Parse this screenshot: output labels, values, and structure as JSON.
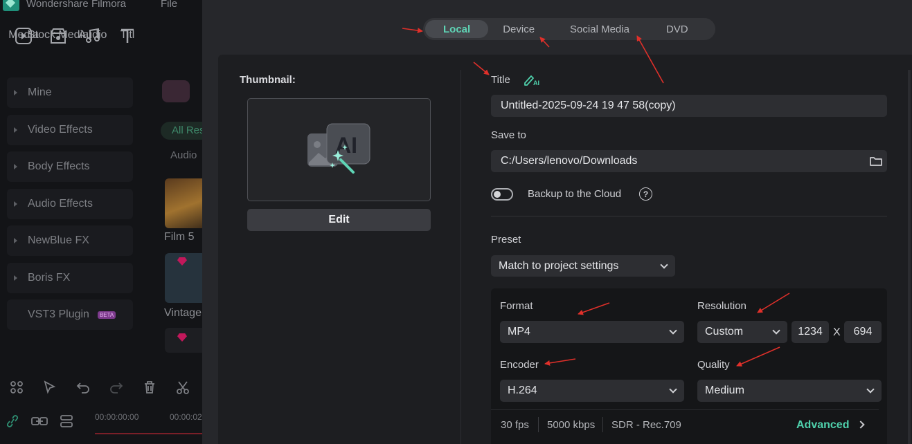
{
  "background_app": {
    "app_name": "Wondershare Filmora",
    "menu_file": "File",
    "toolbar": [
      "Media",
      "Stock Media",
      "Audio",
      "Titl"
    ],
    "sidebar": [
      "Mine",
      "Video Effects",
      "Body Effects",
      "Audio Effects",
      "NewBlue FX",
      "Boris FX",
      "VST3 Plugin"
    ],
    "beta_badge": "BETA",
    "filter_all": "All Res",
    "filter_audio": "Audio",
    "cards": [
      "Film 5",
      "Vintage"
    ],
    "timecode_start": "00:00:00:00",
    "timecode_next": "00:00:02"
  },
  "tabs": [
    "Local",
    "Device",
    "Social Media",
    "DVD"
  ],
  "active_tab": "Local",
  "thumbnail": {
    "label": "Thumbnail:",
    "edit_button": "Edit",
    "ai_badge": "AI"
  },
  "form": {
    "title_label": "Title",
    "ai_badge": "AI",
    "title_value": "Untitled-2025-09-24 19 47 58(copy)",
    "save_to_label": "Save to",
    "save_to_value": "C:/Users/lenovo/Downloads",
    "backup_label": "Backup to the Cloud",
    "backup_enabled": false,
    "help_glyph": "?",
    "preset_label": "Preset",
    "preset_value": "Match to project settings"
  },
  "settings": {
    "format_label": "Format",
    "format_value": "MP4",
    "resolution_label": "Resolution",
    "resolution_value": "Custom",
    "width": "1234",
    "times": "X",
    "height": "694",
    "encoder_label": "Encoder",
    "encoder_value": "H.264",
    "quality_label": "Quality",
    "quality_value": "Medium",
    "fps": "30 fps",
    "bitrate": "5000 kbps",
    "color_space": "SDR - Rec.709",
    "advanced_label": "Advanced"
  },
  "colors": {
    "accent": "#4fd1ac",
    "annotation_arrow": "#e0302a"
  }
}
